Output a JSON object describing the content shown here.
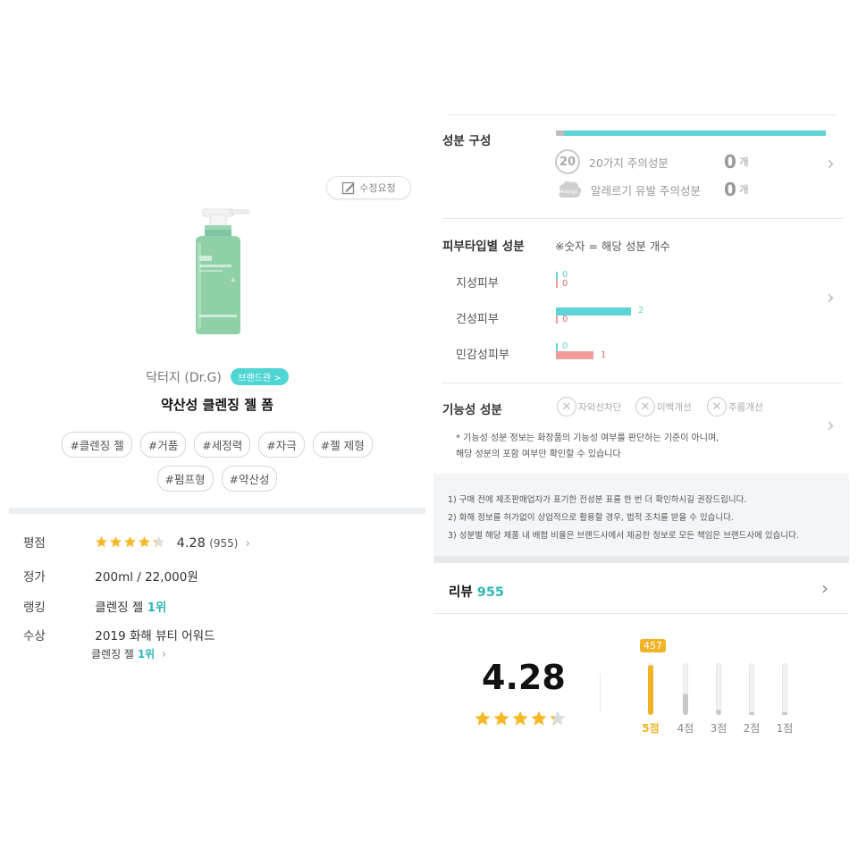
{
  "left": {
    "edit_request": "수정요청",
    "brand": "닥터지 (Dr.G)",
    "brand_tag": "브랜드관 >",
    "product_name": "약산성 클렌징 젤 폼",
    "tags": [
      "#클렌징 젤",
      "#거품",
      "#세정력",
      "#자극",
      "#젤 제형",
      "#펌프형",
      "#약산성"
    ],
    "rows": {
      "rating_label": "평점",
      "rating_value": "4.28",
      "rating_count": "(955)",
      "rating_stars": 4.28,
      "price_label": "정가",
      "price_value": "200ml / 22,000원",
      "rank_label": "랭킹",
      "rank_category": "클렌징 젤",
      "rank_value": "1위",
      "award_label": "수상",
      "award_value": "2019 화해 뷰티 어워드",
      "award_sub_category": "클렌징 젤",
      "award_sub_rank": "1위"
    }
  },
  "right": {
    "composition": {
      "title": "성분 구성",
      "caution_icon": "20",
      "caution_label": "20가지 주의성분",
      "caution_count": "0",
      "unit": "개",
      "allergy_icon": "Allergy",
      "allergy_label": "알레르기 유발 주의성분",
      "allergy_count": "0"
    },
    "skin": {
      "title": "피부타입별 성분",
      "note": "※숫자 = 해당 성분 개수",
      "types": [
        {
          "label": "지성피부",
          "good": 0,
          "bad": 0
        },
        {
          "label": "건성피부",
          "good": 2,
          "bad": 0
        },
        {
          "label": "민감성피부",
          "good": 0,
          "bad": 1
        }
      ]
    },
    "functional": {
      "title": "기능성 성분",
      "items": [
        "자외선차단",
        "미백개선",
        "주름개선"
      ],
      "note1": "* 기능성 성분 정보는 화장품의 기능성 여부를 판단하는 기준이 아니며,",
      "note2": "해당 성분의 포함 여부만 확인할 수 있습니다"
    },
    "notices": [
      "1) 구매 전에 제조판매업자가 표기한 전성분 표를 한 번 더 확인하시길 권장드립니다.",
      "2) 화해 정보를 허가없이 상업적으로 활용할 경우, 법적 조치를 받을 수 있습니다.",
      "3) 성분별 해당 제품 내 배합 비율은 브랜드사에서 제공한 정보로 모든 책임은 브랜드사에 있습니다."
    ],
    "review": {
      "title": "리뷰",
      "count": "955",
      "rating": "4.28",
      "rating_stars": 4.28,
      "top_badge": "457",
      "distribution": [
        {
          "label": "5점",
          "fraction": 0.96
        },
        {
          "label": "4점",
          "fraction": 0.42
        },
        {
          "label": "3점",
          "fraction": 0.1
        },
        {
          "label": "2점",
          "fraction": 0.03
        },
        {
          "label": "1점",
          "fraction": 0.02
        }
      ]
    }
  },
  "colors": {
    "accent": "#2fb7b5",
    "teal_bar": "#5ed4d6",
    "red_bar": "#f29b9b",
    "star": "#f5b92a",
    "review_bar": "#f0b323"
  },
  "icons": [
    "edit-icon",
    "star-icon",
    "chevron-right-icon",
    "x-circle-icon",
    "allergy-icon",
    "caution-20-icon"
  ]
}
